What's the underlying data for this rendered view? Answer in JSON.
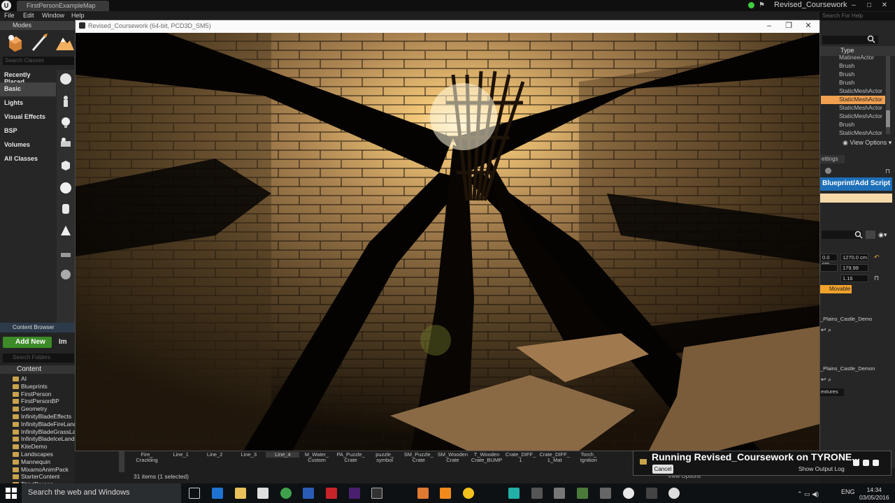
{
  "editor": {
    "map_tab": "FirstPersonExampleMap",
    "project_name": "Revised_Coursework",
    "search_help_placeholder": "Search For Help",
    "menu": [
      "File",
      "Edit",
      "Window",
      "Help"
    ]
  },
  "modes": {
    "header": "Modes",
    "search_placeholder": "Search Classes",
    "categories": [
      "Recently Placed",
      "Basic",
      "Lights",
      "Visual Effects",
      "BSP",
      "Volumes",
      "All Classes"
    ]
  },
  "content_browser": {
    "header": "Content Browser",
    "add_new": "Add New",
    "import": "Im",
    "search_placeholder": "Search Folders",
    "root": "Content",
    "folders": [
      "AI",
      "Blueprints",
      "FirstPerson",
      "FirstPersonBP",
      "Geometry",
      "InfinityBladeEffects",
      "InfinityBladeFireLands",
      "InfinityBladeGrassLands",
      "InfinityBladeIceLands",
      "KiteDemo",
      "Landscapes",
      "Mannequin",
      "MixamoAnimPack",
      "StarterContent",
      "ThirdPerson"
    ]
  },
  "assets": [
    {
      "label": "Fire_\nCrackling",
      "selected": false
    },
    {
      "label": "Line_1",
      "selected": false
    },
    {
      "label": "Line_2",
      "selected": false
    },
    {
      "label": "Line_3",
      "selected": false
    },
    {
      "label": "Line_4",
      "selected": true
    },
    {
      "label": "M_Water_\nCustom",
      "selected": false
    },
    {
      "label": "PA_Puzzle_\nCrate",
      "selected": false
    },
    {
      "label": "puzzle_\nsymbol",
      "selected": false
    },
    {
      "label": "SM_Puzzle_\nCrate",
      "selected": false
    },
    {
      "label": "SM_Wooden\nCrate",
      "selected": false
    },
    {
      "label": "T_Wooden\nCrate_BUMP",
      "selected": false
    },
    {
      "label": "Crate_DIFF_\n1",
      "selected": false
    },
    {
      "label": "Crate_DIFF_\n1_Mat",
      "selected": false
    },
    {
      "label": "Torch_\nIgnition",
      "selected": false
    }
  ],
  "items_count": "31 items (1 selected)",
  "view_options_bottom": "View Options",
  "game_window": {
    "title": "Revised_Coursework (64-bit, PCD3D_SM5)"
  },
  "outliner": {
    "column_type": "Type",
    "rows": [
      {
        "label": "MatineeActor",
        "selected": false
      },
      {
        "label": "Brush",
        "selected": false
      },
      {
        "label": "Brush",
        "selected": false
      },
      {
        "label": "Brush",
        "selected": false
      },
      {
        "label": "StaticMeshActor",
        "selected": false
      },
      {
        "label": "StaticMeshActor",
        "selected": true
      },
      {
        "label": "StaticMeshActor",
        "selected": false
      },
      {
        "label": "StaticMeshActor",
        "selected": false
      },
      {
        "label": "Brush",
        "selected": false
      },
      {
        "label": "StaticMeshActor",
        "selected": false
      }
    ],
    "view_options": "View Options"
  },
  "details": {
    "tab": "ettings",
    "blueprint_button": "Blueprint/Add Script",
    "location_y": "0.0 cm",
    "location_z": "1270.0 cm",
    "rotation_z": "179.99",
    "scale_z": "1.16",
    "mobility": "Movable",
    "mesh_ref": "_Plains_Castle_Demo",
    "material_ref": "_Plains_Castle_Demon",
    "textures_dd": "extures"
  },
  "toast": {
    "text": "Running Revised_Coursework on TYRONE...",
    "cancel": "Cancel",
    "output_log": "Show Output Log"
  },
  "taskbar": {
    "search_placeholder": "Search the web and Windows",
    "language": "ENG",
    "time": "14:34",
    "date": "03/05/2016"
  },
  "colors": {
    "accent_blue": "#1d6fb8",
    "selection_orange": "#f0a050",
    "add_new_green": "#3c8b28"
  }
}
